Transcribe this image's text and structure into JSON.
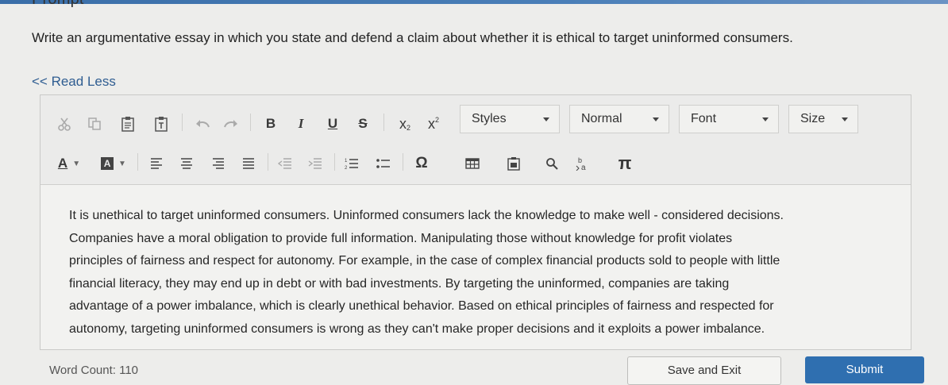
{
  "page": {
    "heading": "Prompt",
    "prompt_text": "Write an argumentative essay in which you state and defend a claim about whether it is ethical to target uninformed consumers.",
    "read_less": "<< Read Less"
  },
  "toolbar": {
    "bold": "B",
    "italic": "I",
    "underline": "U",
    "strike": "S",
    "subscript": "x",
    "subscript_mark": "2",
    "superscript": "x",
    "superscript_mark": "2",
    "styles_value": "Styles",
    "format_value": "Normal",
    "font_value": "Font",
    "size_value": "Size",
    "font_color_letter": "A",
    "special_char": "Ω",
    "pi": "π",
    "icons": [
      "cut-icon",
      "copy-icon",
      "paste-icon",
      "paste-text-icon",
      "undo-icon",
      "redo-icon",
      "align-left-icon",
      "align-center-icon",
      "align-right-icon",
      "align-justify-icon",
      "outdent-icon",
      "indent-icon",
      "numbered-list-icon",
      "bulleted-list-icon",
      "table-icon",
      "image-icon",
      "find-icon",
      "replace-icon"
    ]
  },
  "editor": {
    "lines": [
      "It is unethical to target uninformed consumers. Uninformed consumers lack the knowledge to make well - considered decisions.",
      "Companies have a moral obligation to provide full information. Manipulating those without knowledge for profit violates",
      "principles of fairness and respect for autonomy. For example, in the case of complex financial products sold to people with little",
      "financial literacy, they may end up in debt or with bad investments. By targeting the uninformed, companies are taking",
      "advantage of a power imbalance, which is clearly unethical behavior. Based on ethical principles of fairness and respected for",
      "autonomy, targeting uninformed consumers is wrong as they can't make proper decisions and it exploits a power imbalance."
    ]
  },
  "footer": {
    "word_count": "Word Count: 110",
    "save_exit": "Save and Exit",
    "submit": "Submit"
  },
  "colors": {
    "accent": "#2f6fb0",
    "link": "#2f5d91",
    "background": "#ededeb"
  }
}
